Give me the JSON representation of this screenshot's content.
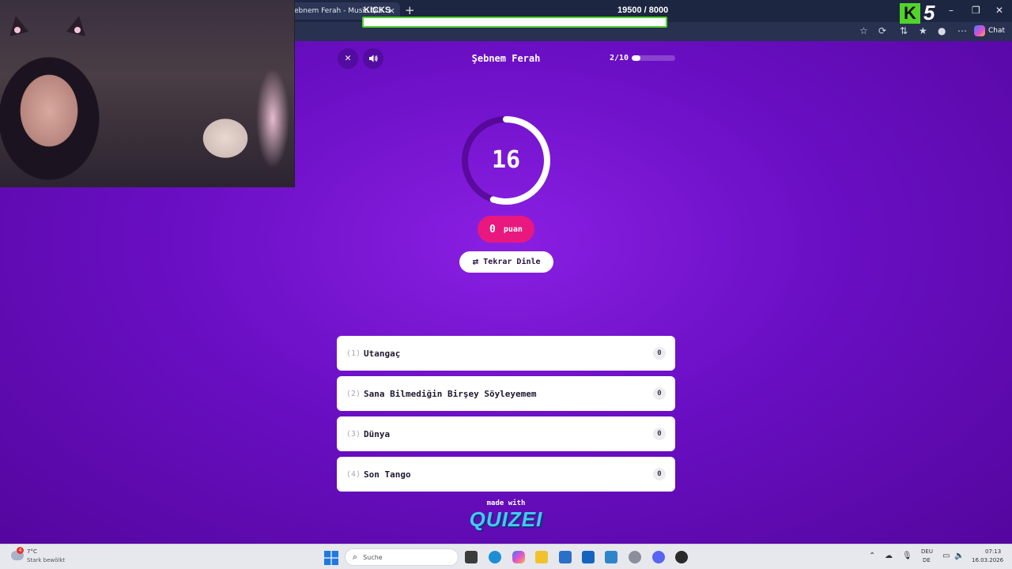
{
  "browser": {
    "tab_title": "ebnem Ferah - Music Qui",
    "tab_close": "×",
    "new_tab": "+",
    "chat_label": "Chat"
  },
  "kicks_overlay": {
    "label": "KICKS",
    "count_text": "19500  / 8000",
    "progress": 1.0,
    "logo_letter": "K",
    "logo_number": "5",
    "accent_color": "#52d32a"
  },
  "quiz": {
    "title": "Şebnem Ferah",
    "progress_label": "2/10",
    "progress_fraction": 0.2,
    "timer_value": "16",
    "timer_fraction": 0.55,
    "score_value": "0",
    "score_unit": "puan",
    "replay_label": "Tekrar Dinle",
    "answers": [
      {
        "number": "(1)",
        "text": "Utangaç",
        "count": "0"
      },
      {
        "number": "(2)",
        "text": "Sana Bilmediğin Birşey Söyleyemem",
        "count": "0"
      },
      {
        "number": "(3)",
        "text": "Dünya",
        "count": "0"
      },
      {
        "number": "(4)",
        "text": "Son Tango",
        "count": "0"
      }
    ],
    "made_with": "made with",
    "brand": "QUIZEI",
    "colors": {
      "background": "#6a0fc4",
      "score_pill": "#e8187f",
      "brand": "#45c8f5"
    }
  },
  "taskbar": {
    "weather_temp": "7°C",
    "weather_desc": "Stark bewölkt",
    "weather_badge": "4",
    "search_placeholder": "Suche",
    "lang_top": "DEU",
    "lang_bottom": "DE",
    "time": "07:13",
    "date": "16.03.2026"
  },
  "icons": {
    "close": "close-icon",
    "sound": "speaker-icon",
    "replay": "repeat-icon",
    "search": "search-icon",
    "windows": "windows-logo-icon"
  }
}
